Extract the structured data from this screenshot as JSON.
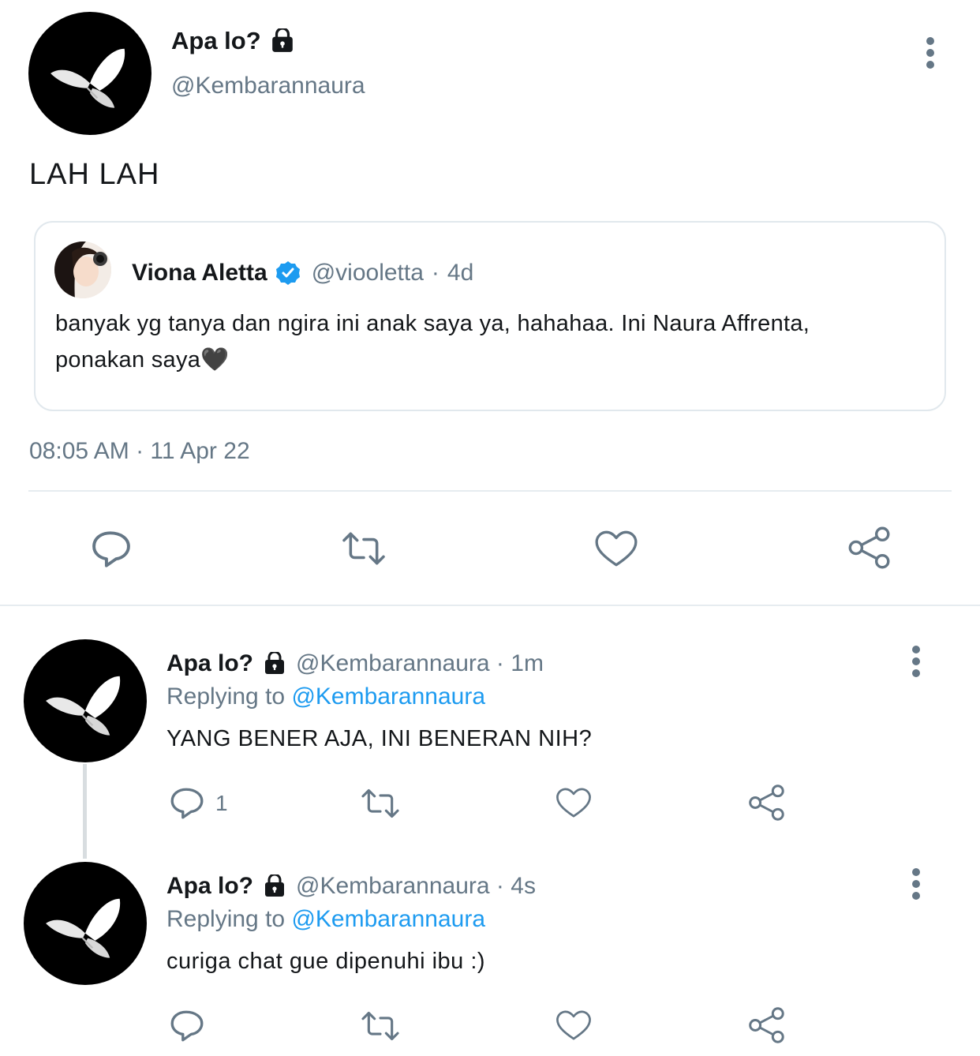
{
  "main_tweet": {
    "display_name": "Apa lo?",
    "handle": "@Kembarannaura",
    "text": "LAH LAH",
    "timestamp": "08:05 AM · 11 Apr 22",
    "lock_icon": "lock-icon",
    "avatar_icon": "butterfly-icon"
  },
  "quoted_tweet": {
    "display_name": "Viona Aletta",
    "handle": "@viooletta",
    "separator": "·",
    "age": "4d",
    "text_line1": "banyak yg tanya dan ngira ini anak saya ya, hahahaa. Ini Naura Affrenta,",
    "text_line2": "ponakan saya🖤",
    "verified_icon": "verified-badge-icon"
  },
  "replies": [
    {
      "display_name": "Apa lo?",
      "handle": "@Kembarannaura · 1m",
      "replying_prefix": "Replying to",
      "replying_handle": "@Kembarannaura",
      "text": "YANG BENER AJA, INI BENERAN NIH?",
      "reply_count": "1"
    },
    {
      "display_name": "Apa lo?",
      "handle": "@Kembarannaura · 4s",
      "replying_prefix": "Replying to",
      "replying_handle": "@Kembarannaura",
      "text": "curiga chat gue dipenuhi ibu :)",
      "reply_count": ""
    }
  ],
  "colors": {
    "text": "#14171a",
    "secondary": "#657786",
    "link": "#1d9bf0",
    "divider": "#e6ecf0"
  }
}
